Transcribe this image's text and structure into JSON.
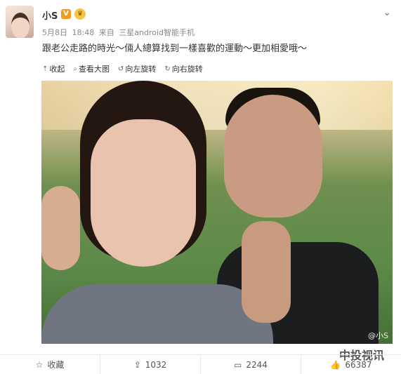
{
  "post": {
    "username": "小S",
    "badge_v": "V",
    "meta": {
      "date": "5月8日",
      "time": "18:48",
      "from_label": "来自",
      "device": "三星android智能手机"
    },
    "text": "跟老公走路的時光～倆人總算找到一樣喜歡的運動～更加相愛哦～"
  },
  "actions": [
    {
      "label": "收起",
      "icon": "collapse-arrow-icon"
    },
    {
      "label": "查看大图",
      "icon": "magnifier-icon"
    },
    {
      "label": "向左旋转",
      "icon": "rotate-left-icon"
    },
    {
      "label": "向右旋转",
      "icon": "rotate-right-icon"
    }
  ],
  "photo": {
    "watermark": "@小S"
  },
  "bottom_bar": {
    "favorite_label": "收藏",
    "repost_count": "1032",
    "comment_count": "2244",
    "like_count": "66387"
  },
  "overlay": {
    "brand_text": "中投视讯"
  },
  "colors": {
    "accent_orange": "#f29b1d",
    "text_main": "#333333",
    "text_meta": "#888888"
  }
}
